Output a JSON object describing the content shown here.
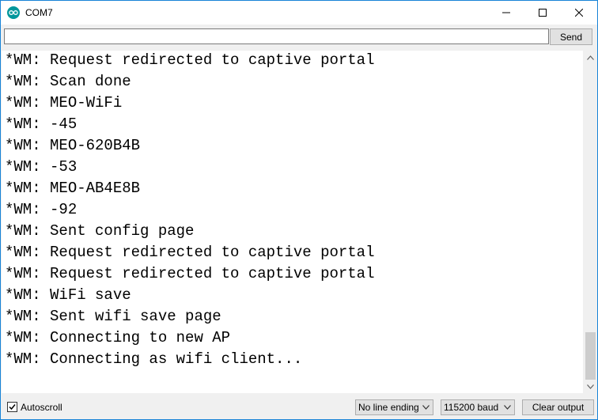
{
  "window": {
    "title": "COM7",
    "icon": "arduino-icon",
    "controls": [
      "minimize-icon",
      "maximize-icon",
      "close-icon"
    ]
  },
  "input": {
    "value": "",
    "send_label": "Send"
  },
  "output": {
    "lines": [
      "*WM: Request redirected to captive portal",
      "*WM: Scan done",
      "*WM: MEO-WiFi",
      "*WM: -45",
      "*WM: MEO-620B4B",
      "*WM: -53",
      "*WM: MEO-AB4E8B",
      "*WM: -92",
      "*WM: Sent config page",
      "*WM: Request redirected to captive portal",
      "*WM: Request redirected to captive portal",
      "*WM: WiFi save",
      "*WM: Sent wifi save page",
      "*WM: Connecting to new AP",
      "*WM: Connecting as wifi client..."
    ]
  },
  "bottom": {
    "autoscroll_label": "Autoscroll",
    "autoscroll_checked": true,
    "line_ending": "No line ending",
    "baud": "115200 baud",
    "clear_label": "Clear output"
  },
  "colors": {
    "window_border": "#1883d7",
    "app_icon": "#00979c"
  }
}
